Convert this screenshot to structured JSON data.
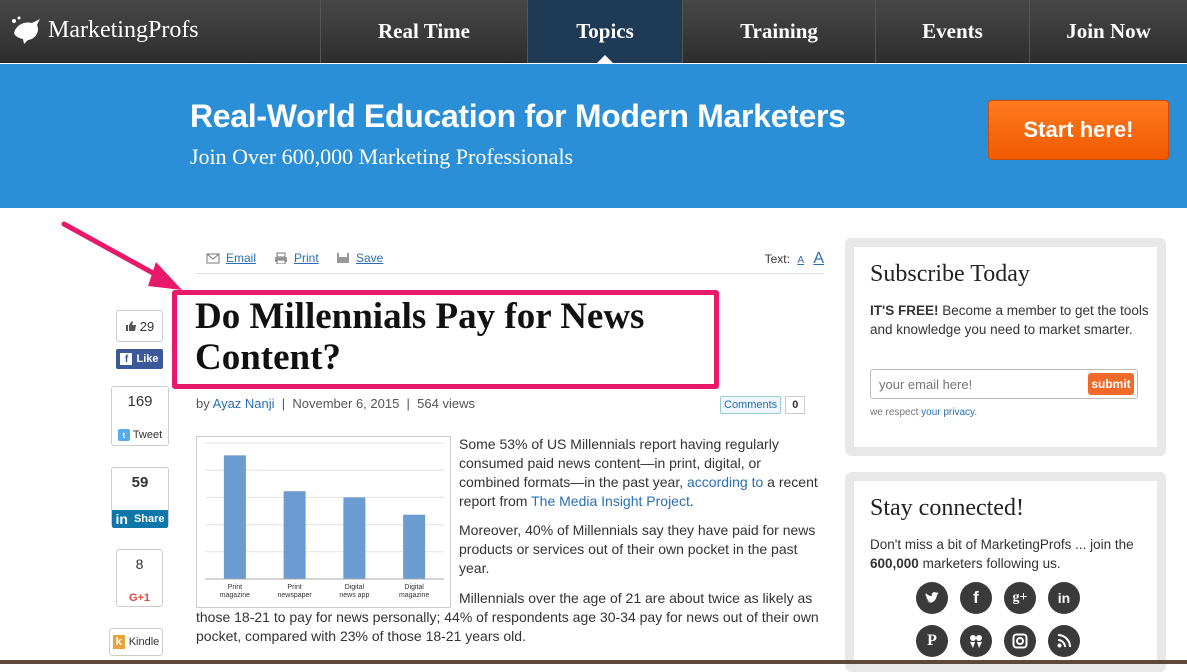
{
  "nav": {
    "logo": "MarketingProfs",
    "items": [
      {
        "label": "Real Time"
      },
      {
        "label": "Topics"
      },
      {
        "label": "Training"
      },
      {
        "label": "Events"
      },
      {
        "label": "Join Now"
      }
    ],
    "active_item": "Topics"
  },
  "banner": {
    "title": "Real-World Education for Modern Marketers",
    "subtitle": "Join Over 600,000 Marketing Professionals",
    "cta": "Start here!"
  },
  "tools": {
    "email": "Email",
    "print": "Print",
    "save": "Save",
    "text_label": "Text:",
    "small_a": "A",
    "large_a": "A"
  },
  "article": {
    "title": "Do Millennials Pay for News Content?",
    "by": "by",
    "author": "Ayaz Nanji",
    "date": "November 6, 2015",
    "views": "564 views",
    "comments_label": "Comments",
    "comments_count": "0",
    "p1_a": "Some 53% of US Millennials report having regularly consumed paid news content—in print, digital, or combined formats—in the past year,",
    "p1_link1": "according to",
    "p1_b": "a recent report from",
    "p1_link2": "The Media Insight Project",
    "p1_c": ".",
    "p2": "Moreover, 40% of Millennials say they have paid for news products or services out of their own pocket in the past year.",
    "p3": "Millennials over the age of 21 are about twice as likely as those 18-21 to pay for news personally; 44% of respondents age 30-34 pay for news out of their own pocket, compared with 23% of those 18-21 years old."
  },
  "share": {
    "like_count": "29",
    "like_label": "Like",
    "tweet_count": "169",
    "tweet_label": "Tweet",
    "linkedin_count": "59",
    "linkedin_label": "Share",
    "gplus_count": "8",
    "gplus_label": "G+1",
    "kindle_label": "Kindle"
  },
  "chart_data": {
    "type": "bar",
    "categories": [
      "Print magazine",
      "Print newspaper",
      "Digital news app",
      "Digital magazine"
    ],
    "category_lines": [
      [
        "Print",
        "magazine"
      ],
      [
        "Print",
        "newspaper"
      ],
      [
        "Digital",
        "news app"
      ],
      [
        "Digital",
        "magazine"
      ]
    ],
    "values": [
      100,
      71,
      66,
      52
    ],
    "ylim": [
      0,
      110
    ],
    "grid": true,
    "bar_color": "#6a9bd1"
  },
  "sidebar": {
    "subscribe_title": "Subscribe Today",
    "free_bold": "IT'S FREE!",
    "free_text": "Become a member to get the tools and knowledge you need to market smarter.",
    "email_placeholder": "your email here!",
    "submit": "submit",
    "privacy_pre": "we respect",
    "privacy_link": "your privacy",
    "privacy_post": ".",
    "connected_title": "Stay connected!",
    "connected_text_a": "Don't miss a bit of MarketingProfs ... join the",
    "connected_bold": "600,000",
    "connected_text_b": "marketers following us.",
    "social_icons": [
      "twitter-icon",
      "facebook-icon",
      "google-plus-icon",
      "linkedin-icon",
      "pinterest-icon",
      "slideshare-icon",
      "instagram-icon",
      "rss-icon"
    ]
  },
  "colors": {
    "nav_bg": "#3a3a3a",
    "banner_bg": "#2a8fd6",
    "cta": "#f26a10",
    "highlight": "#e8196a",
    "link": "#2a6eb5"
  }
}
